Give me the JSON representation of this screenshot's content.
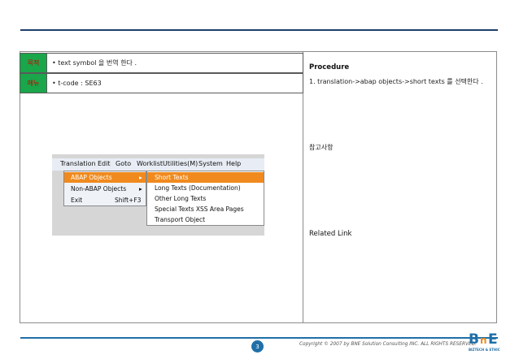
{
  "table": {
    "rows": [
      {
        "label": "목적",
        "value": "• text symbol 을 번역 한다 ."
      },
      {
        "label": "메뉴",
        "value": "• t-code : SE63"
      }
    ]
  },
  "procedure": {
    "title": "Procedure",
    "step1": "1. translation->abap objects->short texts 를 선택한다 ."
  },
  "reference": "참고사항",
  "related_link": "Related Link",
  "screenshot": {
    "menubar": [
      "Translation",
      "Edit",
      "Goto",
      "Worklist",
      "Utilities(M)",
      "System",
      "Help"
    ],
    "menu1": [
      {
        "label": "ABAP Objects",
        "arrow": "▸"
      },
      {
        "label": "Non-ABAP Objects",
        "arrow": "▸"
      },
      {
        "label": "Exit",
        "shortcut": "Shift+F3"
      }
    ],
    "menu2": [
      "Short Texts",
      "Long Texts (Documentation)",
      "Other Long Texts",
      "Special Texts XSS Area Pages",
      "Transport Object"
    ]
  },
  "footer": {
    "page": "3",
    "copyright": "Copyright © 2007 by BNE Solution Consulting INC.   ALL RIGHTS RESERVED.",
    "logo_main": "BnE",
    "logo_sub": "BIZTECH & ETHIC"
  },
  "colors": {
    "accent": "#1f3f6b",
    "label_green": "#1aa64a",
    "highlight": "#f08a1e"
  }
}
